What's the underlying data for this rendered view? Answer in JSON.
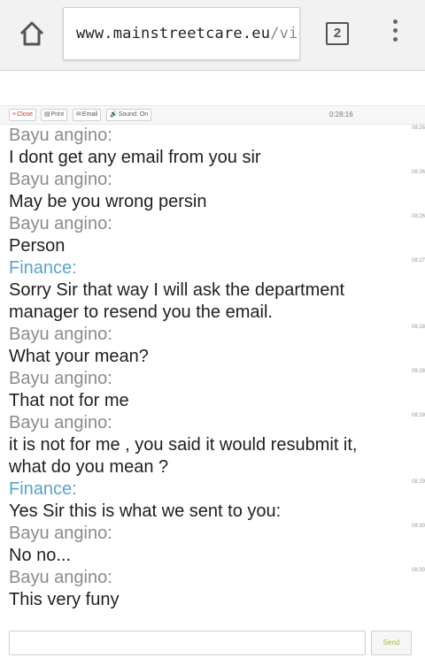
{
  "browser": {
    "url_host": "www.mainstreetcare.eu",
    "url_path": "/visi",
    "tab_count": "2",
    "icons": {
      "home": "home-icon",
      "menu": "overflow-menu-icon"
    }
  },
  "toolbar": {
    "close_label": "Close",
    "print_label": "Print",
    "email_label": "Email",
    "sound_label": "Sound: On",
    "timer": "0:28:16"
  },
  "messages": [
    {
      "sender": "Bayu angino:",
      "role": "visitor",
      "text": "I dont get any email from you sir",
      "time": "08:26"
    },
    {
      "sender": "Bayu angino:",
      "role": "visitor",
      "text": "May be you wrong persin",
      "time": "08:26"
    },
    {
      "sender": "Bayu angino:",
      "role": "visitor",
      "text": "Person",
      "time": "08:26"
    },
    {
      "sender": "Finance:",
      "role": "agent",
      "text": "Sorry Sir that way I will ask the department manager to resend you the email.",
      "time": "08:27"
    },
    {
      "sender": "Bayu angino:",
      "role": "visitor",
      "text": "What your mean?",
      "time": "08:28"
    },
    {
      "sender": "Bayu angino:",
      "role": "visitor",
      "text": "That not for me",
      "time": "08:28"
    },
    {
      "sender": "Bayu angino:",
      "role": "visitor",
      "text": "it is not for me , you said it would resubmit it, what do you mean ?",
      "time": "08:29"
    },
    {
      "sender": "Finance:",
      "role": "agent",
      "text": "Yes Sir this is what we sent to you:",
      "time": "08:29"
    },
    {
      "sender": "Bayu angino:",
      "role": "visitor",
      "text": "No no...",
      "time": "08:30"
    },
    {
      "sender": "Bayu angino:",
      "role": "visitor",
      "text": "This very funy",
      "time": "08:30"
    }
  ],
  "input": {
    "value": "",
    "send_label": "Send"
  },
  "colors": {
    "agent_name": "#5aa4c9",
    "visitor_name": "#8b8b8b",
    "close": "#c0392b",
    "send": "#a8b84a"
  }
}
